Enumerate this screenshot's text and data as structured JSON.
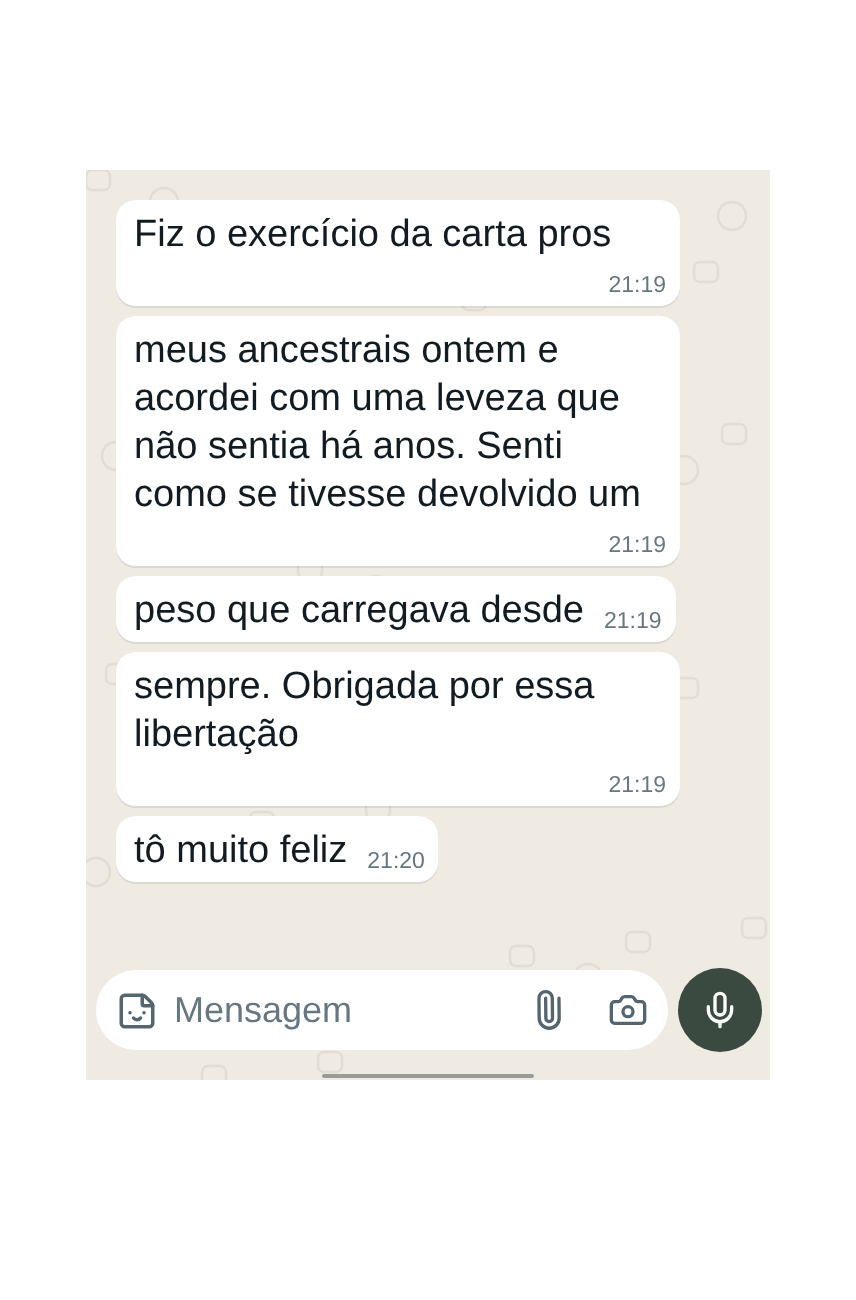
{
  "messages": [
    {
      "text": "Fiz o exercício da carta pros",
      "time": "21:19"
    },
    {
      "text": "meus ancestrais ontem e acordei com uma leveza que não sentia há anos. Senti como se tivesse devolvido um",
      "time": "21:19"
    },
    {
      "text": "peso que carregava desde",
      "time": "21:19"
    },
    {
      "text": "sempre.  Obrigada por essa libertação",
      "time": "21:19"
    },
    {
      "text": "tô muito feliz",
      "time": "21:20"
    }
  ],
  "composer": {
    "placeholder": "Mensagem"
  }
}
